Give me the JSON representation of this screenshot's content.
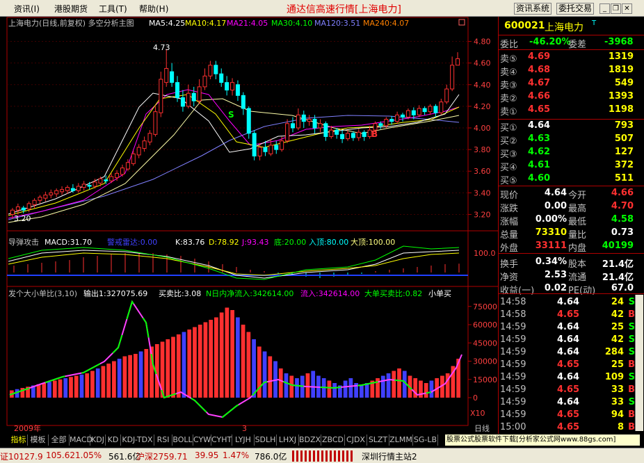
{
  "menu": {
    "items": [
      "资讯(I)",
      "港股期货",
      "工具(T)",
      "帮助(H)"
    ],
    "app_title": "通达信高速行情[上海电力]",
    "btn_news": "资讯系统",
    "btn_trade": "委托交易"
  },
  "chart": {
    "main_title": "上海电力(日线,前复权) 多空分析主图",
    "ma_labels": [
      {
        "text": "MA5:4.25",
        "color": "#ffffff"
      },
      {
        "text": "MA10:4.17",
        "color": "#ffff00"
      },
      {
        "text": "MA21:4.05",
        "color": "#ff00ff"
      },
      {
        "text": "MA30:4.10",
        "color": "#00ff00"
      },
      {
        "text": "MA120:3.51",
        "color": "#8080ff"
      },
      {
        "text": "MA240:4.07",
        "color": "#ff8000"
      }
    ],
    "price_axis": [
      "4.80",
      "4.60",
      "4.40",
      "4.20",
      "4.00",
      "3.80",
      "3.60",
      "3.40",
      "3.20"
    ],
    "high_label": "4.73",
    "low_label": "3.20",
    "signal_s": "S",
    "signal_b": "B",
    "macd_title": "导弹攻击",
    "macd_val": "MACD:31.70",
    "macd_warn": "警戒雷达:0.00",
    "kdj_k": "K:83.76",
    "kdj_d": "D:78.92",
    "kdj_j": "J:93.43",
    "kdj_bottom": "底:20.00",
    "kdj_in": "入顶:80.00",
    "kdj_top": "大顶:100.00",
    "macd_axis": "100.0",
    "vol_title": "发个大小单比(3,10)",
    "vol_out": "输出1:327075.69",
    "vol_ratio": "买卖比:3.08",
    "vol_net": "N日内净流入:342614.00",
    "vol_in": "流入:342614.00",
    "vol_big": "大单买卖比:0.82",
    "vol_small": "小单买",
    "vol_axis": [
      "75000",
      "60000",
      "45000",
      "30000",
      "15000",
      "0"
    ],
    "x10": "X10",
    "year": "2009年",
    "month": "3",
    "day_label": "日线"
  },
  "quote": {
    "code": "600021",
    "name": "上海电力",
    "weibi_l": "委比",
    "weibi_v": "-46.20%",
    "weicha_l": "委差",
    "weicha_v": "-3968",
    "asks": [
      {
        "l": "卖⑤",
        "p": "4.69",
        "v": "1319"
      },
      {
        "l": "卖④",
        "p": "4.68",
        "v": "1819"
      },
      {
        "l": "卖③",
        "p": "4.67",
        "v": "549"
      },
      {
        "l": "卖②",
        "p": "4.66",
        "v": "1393"
      },
      {
        "l": "卖①",
        "p": "4.65",
        "v": "1198"
      }
    ],
    "bids": [
      {
        "l": "买①",
        "p": "4.64",
        "v": "793"
      },
      {
        "l": "买②",
        "p": "4.63",
        "v": "507"
      },
      {
        "l": "买③",
        "p": "4.62",
        "v": "127"
      },
      {
        "l": "买④",
        "p": "4.61",
        "v": "372"
      },
      {
        "l": "买⑤",
        "p": "4.60",
        "v": "511"
      }
    ],
    "stats": [
      {
        "l1": "现价",
        "v1": "4.64",
        "c1": "#ffffff",
        "l2": "今开",
        "v2": "4.66",
        "c2": "#ff3030"
      },
      {
        "l1": "涨跌",
        "v1": "0.00",
        "c1": "#ffffff",
        "l2": "最高",
        "v2": "4.70",
        "c2": "#ff3030"
      },
      {
        "l1": "涨幅",
        "v1": "0.00%",
        "c1": "#ffffff",
        "l2": "最低",
        "v2": "4.58",
        "c2": "#00ff00"
      },
      {
        "l1": "总量",
        "v1": "73310",
        "c1": "#ffff00",
        "l2": "量比",
        "v2": "0.73",
        "c2": "#ffffff"
      },
      {
        "l1": "外盘",
        "v1": "33111",
        "c1": "#ff3030",
        "l2": "内盘",
        "v2": "40199",
        "c2": "#00ff00"
      },
      {
        "l1": "换手",
        "v1": "0.34%",
        "c1": "#ffffff",
        "l2": "股本",
        "v2": "21.4亿",
        "c2": "#ffffff"
      },
      {
        "l1": "净资",
        "v1": "2.53",
        "c1": "#ffffff",
        "l2": "流通",
        "v2": "21.4亿",
        "c2": "#ffffff"
      },
      {
        "l1": "收益(一)",
        "v1": "0.02",
        "c1": "#ffffff",
        "l2": "PE(动)",
        "v2": "67.0",
        "c2": "#ffffff"
      }
    ],
    "ticks": [
      {
        "t": "14:58",
        "p": "4.64",
        "pc": "#ffffff",
        "v": "24",
        "d": "S"
      },
      {
        "t": "14:58",
        "p": "4.65",
        "pc": "#ff3030",
        "v": "42",
        "d": "B"
      },
      {
        "t": "14:59",
        "p": "4.64",
        "pc": "#ffffff",
        "v": "25",
        "d": "S"
      },
      {
        "t": "14:59",
        "p": "4.64",
        "pc": "#ffffff",
        "v": "42",
        "d": "S"
      },
      {
        "t": "14:59",
        "p": "4.64",
        "pc": "#ffffff",
        "v": "284",
        "d": "S"
      },
      {
        "t": "14:59",
        "p": "4.65",
        "pc": "#ff3030",
        "v": "25",
        "d": "B"
      },
      {
        "t": "14:59",
        "p": "4.64",
        "pc": "#ffffff",
        "v": "109",
        "d": "S"
      },
      {
        "t": "14:59",
        "p": "4.65",
        "pc": "#ff3030",
        "v": "33",
        "d": "B"
      },
      {
        "t": "14:59",
        "p": "4.64",
        "pc": "#ffffff",
        "v": "33",
        "d": "S"
      },
      {
        "t": "14:59",
        "p": "4.65",
        "pc": "#ff3030",
        "v": "94",
        "d": "B"
      },
      {
        "t": "15:00",
        "p": "4.65",
        "pc": "#ff3030",
        "v": "8",
        "d": "B"
      }
    ]
  },
  "tabs": {
    "items": [
      "指标",
      "模板",
      "全部",
      "MACD",
      "KDJ",
      "KD",
      "KDJ-TDX",
      "RSI",
      "BOLL",
      "CYW",
      "CYHT",
      "LYJH",
      "SDLH",
      "LHXJ",
      "BDZX",
      "ZBCD",
      "CJDX",
      "SLZT",
      "ZLMM",
      "SG-LB"
    ],
    "ad": "股票公式股票软件下载[分析家公式网www.88gs.com]"
  },
  "status": {
    "sh_idx": "证10127.9",
    "sh_chg": "105.62",
    "sh_pct": "1.05%",
    "sh_amt": "561.6亿",
    "hs": "沪深2759.71",
    "hs_chg": "39.95",
    "hs_pct": "1.47%",
    "hs_amt": "786.0亿",
    "server": "深圳行情主站2"
  },
  "chart_data": {
    "type": "candlestick",
    "ylim": [
      3.1,
      4.9
    ],
    "candles": [
      [
        3.2,
        3.24,
        3.16,
        3.26
      ],
      [
        3.24,
        3.27,
        3.2,
        3.3
      ],
      [
        3.26,
        3.24,
        3.21,
        3.28
      ],
      [
        3.25,
        3.3,
        3.22,
        3.32
      ],
      [
        3.29,
        3.33,
        3.26,
        3.35
      ],
      [
        3.33,
        3.36,
        3.3,
        3.38
      ],
      [
        3.35,
        3.38,
        3.32,
        3.41
      ],
      [
        3.38,
        3.4,
        3.35,
        3.43
      ],
      [
        3.39,
        3.42,
        3.36,
        3.44
      ],
      [
        3.41,
        3.43,
        3.38,
        3.46
      ],
      [
        3.42,
        3.45,
        3.39,
        3.47
      ],
      [
        3.44,
        3.42,
        3.4,
        3.48
      ],
      [
        3.42,
        3.46,
        3.4,
        3.49
      ],
      [
        3.45,
        3.48,
        3.42,
        3.51
      ],
      [
        3.47,
        3.46,
        3.43,
        3.5
      ],
      [
        3.46,
        3.5,
        3.44,
        3.53
      ],
      [
        3.49,
        3.53,
        3.46,
        3.55
      ],
      [
        3.52,
        3.51,
        3.48,
        3.56
      ],
      [
        3.51,
        3.55,
        3.49,
        3.58
      ],
      [
        3.54,
        3.58,
        3.51,
        3.61
      ],
      [
        3.57,
        3.63,
        3.55,
        3.66
      ],
      [
        3.62,
        3.68,
        3.6,
        3.71
      ],
      [
        3.67,
        3.76,
        3.65,
        3.79
      ],
      [
        3.75,
        3.82,
        3.72,
        3.85
      ],
      [
        3.81,
        3.88,
        3.78,
        3.92
      ],
      [
        3.87,
        3.95,
        3.84,
        3.98
      ],
      [
        3.94,
        4.15,
        3.92,
        4.2
      ],
      [
        4.14,
        4.45,
        4.1,
        4.52
      ],
      [
        4.42,
        4.55,
        4.38,
        4.73
      ],
      [
        4.52,
        4.42,
        4.38,
        4.6
      ],
      [
        4.42,
        4.28,
        4.24,
        4.48
      ],
      [
        4.28,
        4.2,
        4.15,
        4.35
      ],
      [
        4.2,
        4.32,
        4.18,
        4.4
      ],
      [
        4.32,
        4.25,
        4.2,
        4.38
      ],
      [
        4.25,
        4.38,
        4.22,
        4.45
      ],
      [
        4.38,
        4.48,
        4.35,
        4.55
      ],
      [
        4.48,
        4.58,
        4.45,
        4.62
      ],
      [
        4.58,
        4.5,
        4.45,
        4.62
      ],
      [
        4.5,
        4.42,
        4.38,
        4.55
      ],
      [
        4.42,
        4.35,
        4.3,
        4.48
      ],
      [
        4.35,
        4.42,
        4.3,
        4.46
      ],
      [
        4.4,
        4.3,
        4.25,
        4.44
      ],
      [
        4.3,
        4.18,
        4.12,
        4.33
      ],
      [
        4.18,
        3.95,
        3.9,
        4.2
      ],
      [
        3.95,
        3.74,
        3.7,
        3.98
      ],
      [
        3.74,
        3.82,
        3.7,
        3.86
      ],
      [
        3.82,
        3.78,
        3.74,
        3.88
      ],
      [
        3.76,
        3.84,
        3.74,
        3.9
      ],
      [
        3.84,
        3.8,
        3.76,
        3.88
      ],
      [
        3.8,
        3.88,
        3.78,
        3.92
      ],
      [
        3.88,
        4.04,
        3.86,
        4.08
      ],
      [
        4.04,
        4.0,
        3.96,
        4.1
      ],
      [
        4.0,
        4.12,
        3.98,
        4.18
      ],
      [
        4.12,
        4.06,
        4.0,
        4.16
      ],
      [
        4.06,
        4.08,
        4.02,
        4.12
      ],
      [
        4.08,
        4.0,
        3.95,
        4.12
      ],
      [
        4.0,
        4.04,
        3.96,
        4.08
      ],
      [
        4.04,
        3.92,
        3.88,
        4.06
      ],
      [
        3.92,
        3.98,
        3.9,
        4.02
      ],
      [
        3.98,
        3.94,
        3.9,
        4.0
      ],
      [
        3.94,
        3.9,
        3.86,
        3.98
      ],
      [
        3.9,
        3.95,
        3.88,
        3.98
      ],
      [
        3.95,
        3.91,
        3.88,
        3.97
      ],
      [
        3.91,
        3.96,
        3.88,
        3.99
      ],
      [
        3.96,
        3.92,
        3.88,
        3.98
      ],
      [
        3.92,
        3.98,
        3.9,
        4.02
      ],
      [
        3.98,
        4.04,
        3.96,
        4.06
      ],
      [
        4.04,
        4.02,
        3.99,
        4.06
      ],
      [
        4.02,
        4.08,
        4.0,
        4.1
      ],
      [
        4.08,
        4.06,
        4.03,
        4.11
      ],
      [
        4.06,
        4.12,
        4.04,
        4.15
      ],
      [
        4.12,
        4.1,
        4.06,
        4.14
      ],
      [
        4.1,
        4.16,
        4.08,
        4.18
      ],
      [
        4.16,
        4.12,
        4.08,
        4.19
      ],
      [
        4.12,
        4.18,
        4.1,
        4.21
      ],
      [
        4.18,
        4.15,
        4.12,
        4.2
      ],
      [
        4.15,
        4.2,
        4.12,
        4.22
      ],
      [
        4.2,
        4.14,
        4.1,
        4.22
      ],
      [
        4.14,
        4.24,
        4.12,
        4.27
      ],
      [
        4.24,
        4.36,
        4.22,
        4.4
      ],
      [
        4.36,
        4.58,
        4.34,
        4.66
      ],
      [
        4.58,
        4.64,
        4.58,
        4.7
      ]
    ],
    "macd_hist": [
      0.25,
      0.3,
      0.35,
      0.4,
      0.45,
      0.55,
      0.6,
      0.65,
      0.7,
      0.72,
      0.7,
      0.65,
      0.6,
      0.5,
      0.4,
      0.3,
      0.2,
      0.1,
      0.05,
      -0.05,
      -0.1,
      -0.15,
      -0.2,
      -0.15,
      -0.1,
      -0.05,
      0.05,
      0.1,
      0.15,
      0.2,
      0.25,
      0.3,
      0.32
    ],
    "vol_bars": [
      [
        6,
        1
      ],
      [
        7,
        0
      ],
      [
        8,
        1
      ],
      [
        9,
        1
      ],
      [
        10,
        0
      ],
      [
        11,
        1
      ],
      [
        12,
        1
      ],
      [
        13,
        0
      ],
      [
        14,
        1
      ],
      [
        15,
        1
      ],
      [
        16,
        0
      ],
      [
        17,
        1
      ],
      [
        18,
        1
      ],
      [
        19,
        0
      ],
      [
        20,
        1
      ],
      [
        22,
        1
      ],
      [
        24,
        0
      ],
      [
        26,
        1
      ],
      [
        28,
        1
      ],
      [
        30,
        1
      ],
      [
        32,
        0
      ],
      [
        34,
        1
      ],
      [
        35,
        1
      ],
      [
        36,
        1
      ],
      [
        38,
        0
      ],
      [
        40,
        1
      ],
      [
        42,
        1
      ],
      [
        44,
        1
      ],
      [
        46,
        1
      ],
      [
        48,
        1
      ],
      [
        50,
        1
      ],
      [
        52,
        1
      ],
      [
        54,
        0
      ],
      [
        56,
        1
      ],
      [
        58,
        1
      ],
      [
        60,
        1
      ],
      [
        62,
        1
      ],
      [
        64,
        1
      ],
      [
        66,
        1
      ],
      [
        70,
        1
      ],
      [
        74,
        1
      ],
      [
        72,
        1
      ],
      [
        66,
        0
      ],
      [
        60,
        1
      ],
      [
        54,
        1
      ],
      [
        48,
        0
      ],
      [
        42,
        1
      ],
      [
        38,
        0
      ],
      [
        34,
        1
      ],
      [
        30,
        0
      ],
      [
        24,
        1
      ],
      [
        20,
        0
      ],
      [
        18,
        1
      ],
      [
        16,
        0
      ],
      [
        18,
        0
      ],
      [
        20,
        1
      ],
      [
        22,
        0
      ],
      [
        18,
        0
      ],
      [
        16,
        0
      ],
      [
        14,
        1
      ],
      [
        12,
        0
      ],
      [
        10,
        0
      ],
      [
        14,
        0
      ],
      [
        16,
        0
      ],
      [
        12,
        0
      ],
      [
        10,
        0
      ],
      [
        12,
        0
      ],
      [
        14,
        1
      ],
      [
        16,
        1
      ],
      [
        18,
        0
      ],
      [
        20,
        0
      ],
      [
        22,
        1
      ],
      [
        24,
        1
      ],
      [
        22,
        0
      ],
      [
        18,
        1
      ],
      [
        16,
        1
      ],
      [
        14,
        1
      ],
      [
        12,
        1
      ],
      [
        14,
        0
      ],
      [
        16,
        1
      ],
      [
        18,
        1
      ],
      [
        20,
        1
      ],
      [
        26,
        1
      ],
      [
        32,
        1
      ]
    ],
    "series": []
  }
}
